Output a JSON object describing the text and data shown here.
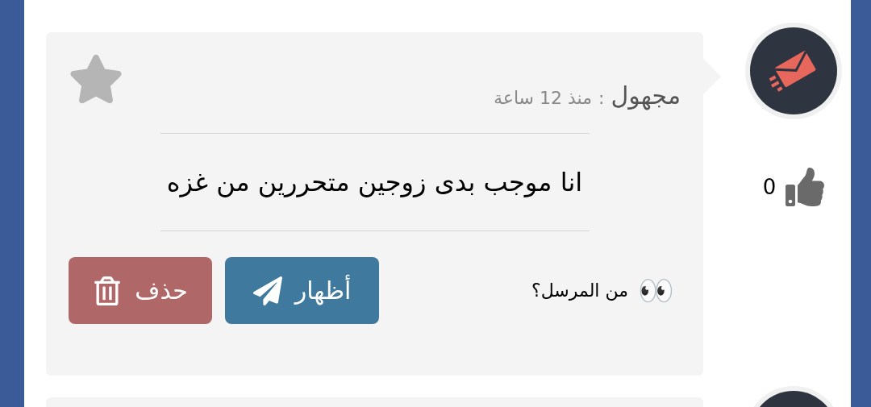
{
  "message": {
    "sender": "مجهول",
    "separator": ":",
    "time": "منذ 12 ساعة",
    "starred": false,
    "body": "انا موجب بدى زوجين متحررين من غزه",
    "sender_hint": {
      "emoji": "👀",
      "text": "من المرسل؟"
    },
    "buttons": [
      {
        "kind": "reveal",
        "label": "أظهار"
      },
      {
        "kind": "delete",
        "label": "حذف"
      }
    ]
  },
  "likes": {
    "count": "0"
  }
}
